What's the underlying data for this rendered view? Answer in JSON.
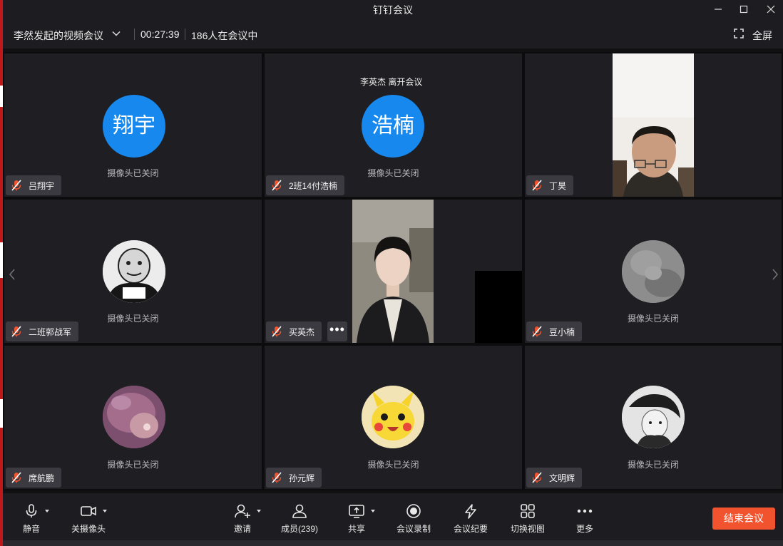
{
  "window": {
    "title": "钉钉会议"
  },
  "info_bar": {
    "meeting_name": "李然发起的视频会议",
    "duration": "00:27:39",
    "participants_in_meeting": "186人在会议中",
    "fullscreen_label": "全屏"
  },
  "tiles": {
    "t1": {
      "name": "吕翔宇",
      "avatar_text": "翔宇",
      "camera_status": "摄像头已关闭"
    },
    "t2": {
      "name": "2班14付浩楠",
      "avatar_text": "浩楠",
      "camera_status": "摄像头已关闭",
      "notice": "李英杰 离开会议"
    },
    "t3": {
      "name": "丁昊"
    },
    "t4": {
      "name": "二班郭战军",
      "camera_status": "摄像头已关闭"
    },
    "t5": {
      "name": "买英杰",
      "more_label": "•••"
    },
    "t6": {
      "name": "豆小楠",
      "camera_status": "摄像头已关闭"
    },
    "t7": {
      "name": "席航鹏",
      "camera_status": "摄像头已关闭"
    },
    "t8": {
      "name": "孙元辉",
      "camera_status": "摄像头已关闭"
    },
    "t9": {
      "name": "文明辉",
      "camera_status": "摄像头已关闭"
    }
  },
  "toolbar": {
    "mute": "静音",
    "camera": "关摄像头",
    "invite": "邀请",
    "members": "成员(239)",
    "share": "共享",
    "record": "会议录制",
    "minutes": "会议纪要",
    "switch_view": "切换视图",
    "more": "更多",
    "end_meeting": "结束会议"
  },
  "colors": {
    "accent_blue": "#1688ee",
    "end_button": "#f2532f",
    "muted_mic": "#f2532f"
  }
}
